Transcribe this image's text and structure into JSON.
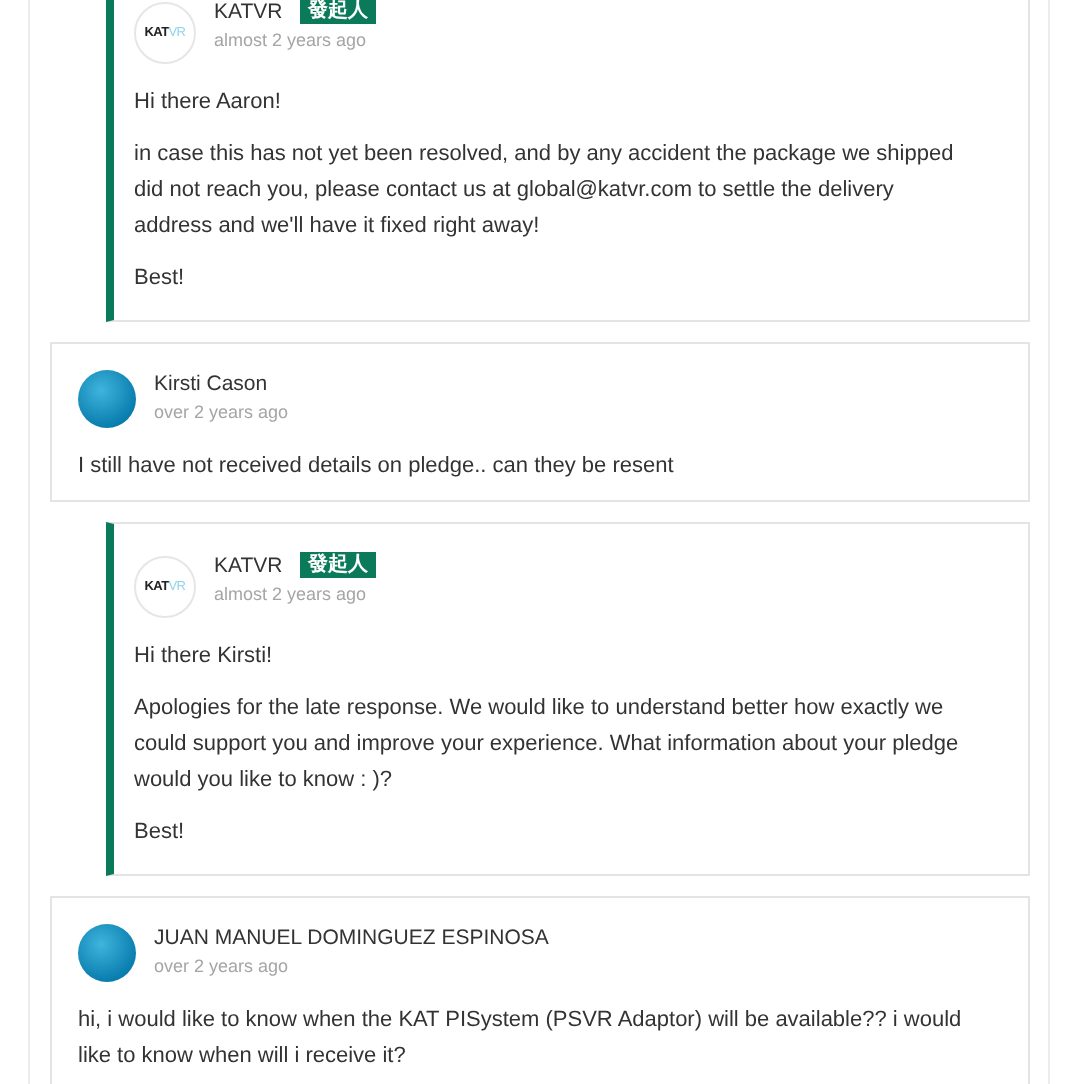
{
  "comments": [
    {
      "kind": "reply",
      "author": "KATVR",
      "badge": "發起人",
      "logo": [
        "KAT",
        "VR"
      ],
      "time": "almost 2 years ago",
      "paragraphs": [
        "Hi there Aaron!",
        "in case this has not yet been resolved, and by any accident the package we shipped did not reach you, please contact us at global@katvr.com to settle the delivery address and we'll have it fixed right away!",
        "Best!"
      ]
    },
    {
      "kind": "comment",
      "author": "Kirsti Cason",
      "time": "over 2 years ago",
      "paragraphs": [
        "I still have not received details on pledge.. can they be resent"
      ]
    },
    {
      "kind": "reply",
      "author": "KATVR",
      "badge": "發起人",
      "logo": [
        "KAT",
        "VR"
      ],
      "time": "almost 2 years ago",
      "paragraphs": [
        "Hi there Kirsti!",
        "Apologies for the late response. We would like to understand better how exactly we could support you and improve your experience. What information about your pledge would you like to know : )?",
        "Best!"
      ]
    },
    {
      "kind": "comment",
      "author": "JUAN MANUEL DOMINGUEZ ESPINOSA",
      "time": "over 2 years ago",
      "paragraphs": [
        "hi, i would like to know when the KAT PISystem (PSVR Adaptor) will be available?? i would like to know when will i receive it?"
      ]
    }
  ]
}
